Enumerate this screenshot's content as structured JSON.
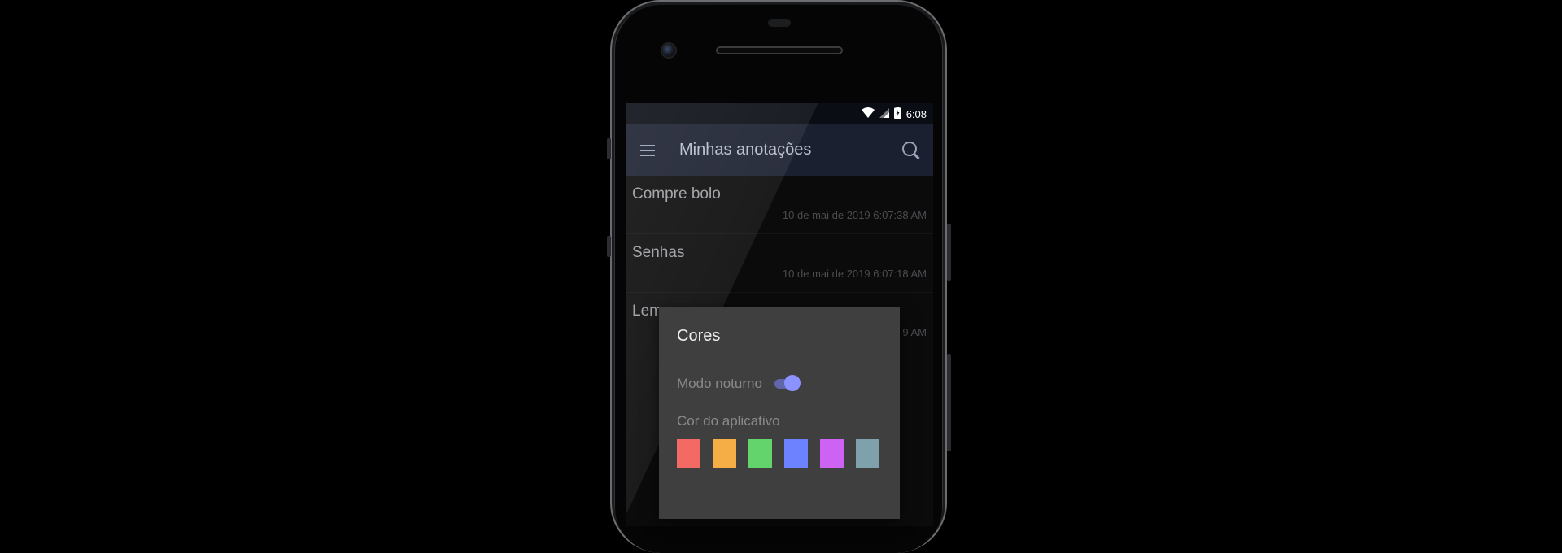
{
  "status_bar": {
    "time": "6:08",
    "icons": [
      "wifi-icon",
      "signal-icon",
      "battery-charging-icon"
    ]
  },
  "app_bar": {
    "title": "Minhas anotações",
    "menu_icon": "menu-icon",
    "search_icon": "search-icon"
  },
  "notes": [
    {
      "title": "Compre bolo",
      "date": "10 de mai de 2019 6:07:38 AM"
    },
    {
      "title": "Senhas",
      "date": "10 de mai de 2019 6:07:18 AM"
    },
    {
      "title": "Lem",
      "date": "9 AM"
    }
  ],
  "dialog": {
    "title": "Cores",
    "night_mode_label": "Modo noturno",
    "night_mode_on": true,
    "app_color_label": "Cor do aplicativo",
    "colors": [
      "#f26a63",
      "#f5ad45",
      "#63d36b",
      "#6c82ff",
      "#cc63f2",
      "#7ea1ac"
    ]
  }
}
